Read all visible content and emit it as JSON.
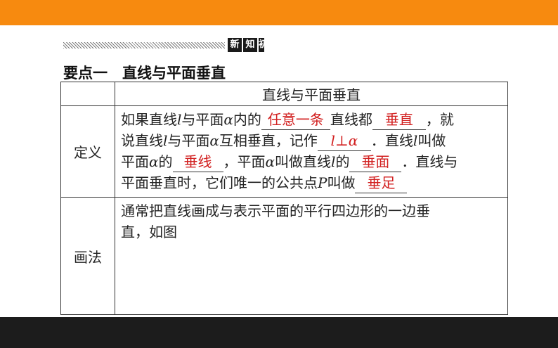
{
  "badge": {
    "c1": "新",
    "c2": "知",
    "c3": "初"
  },
  "heading": "要点一　直线与平面垂直",
  "table": {
    "header_blank": "",
    "header_title": "直线与平面垂直",
    "row1_label": "定义",
    "row2_label": "画法",
    "def": {
      "t1": "如果直线",
      "l": "l",
      "t2": "与平面",
      "alpha": "α",
      "t3": "内的",
      "a1": "任意一条",
      "t4": "直线都",
      "a2": "垂直",
      "t5": "，就",
      "t6": "说直线",
      "t7": "与平面",
      "t8": "互相垂直，记作",
      "a3_l": "l",
      "a3_perp": "⊥",
      "a3_alpha": "α",
      "t9": "．直线",
      "t10": "叫做",
      "t11": "平面",
      "t12": "的",
      "a4": "垂线",
      "t13": "，平面",
      "t14": "叫做直线",
      "t15": "的",
      "a5": "垂面",
      "t16": "．直线与",
      "t17": "平面垂直时，它们唯一的公共点",
      "P": "P",
      "t18": "叫做",
      "a6": "垂足"
    },
    "drawing": {
      "line1": "通常把直线画成与表示平面的平行四边形的一边垂",
      "line2": "直，如图"
    }
  },
  "colors": {
    "top_bar": "#f78a0f",
    "bottom_bar": "#1c1c1c",
    "answer_red": "#d22020"
  }
}
